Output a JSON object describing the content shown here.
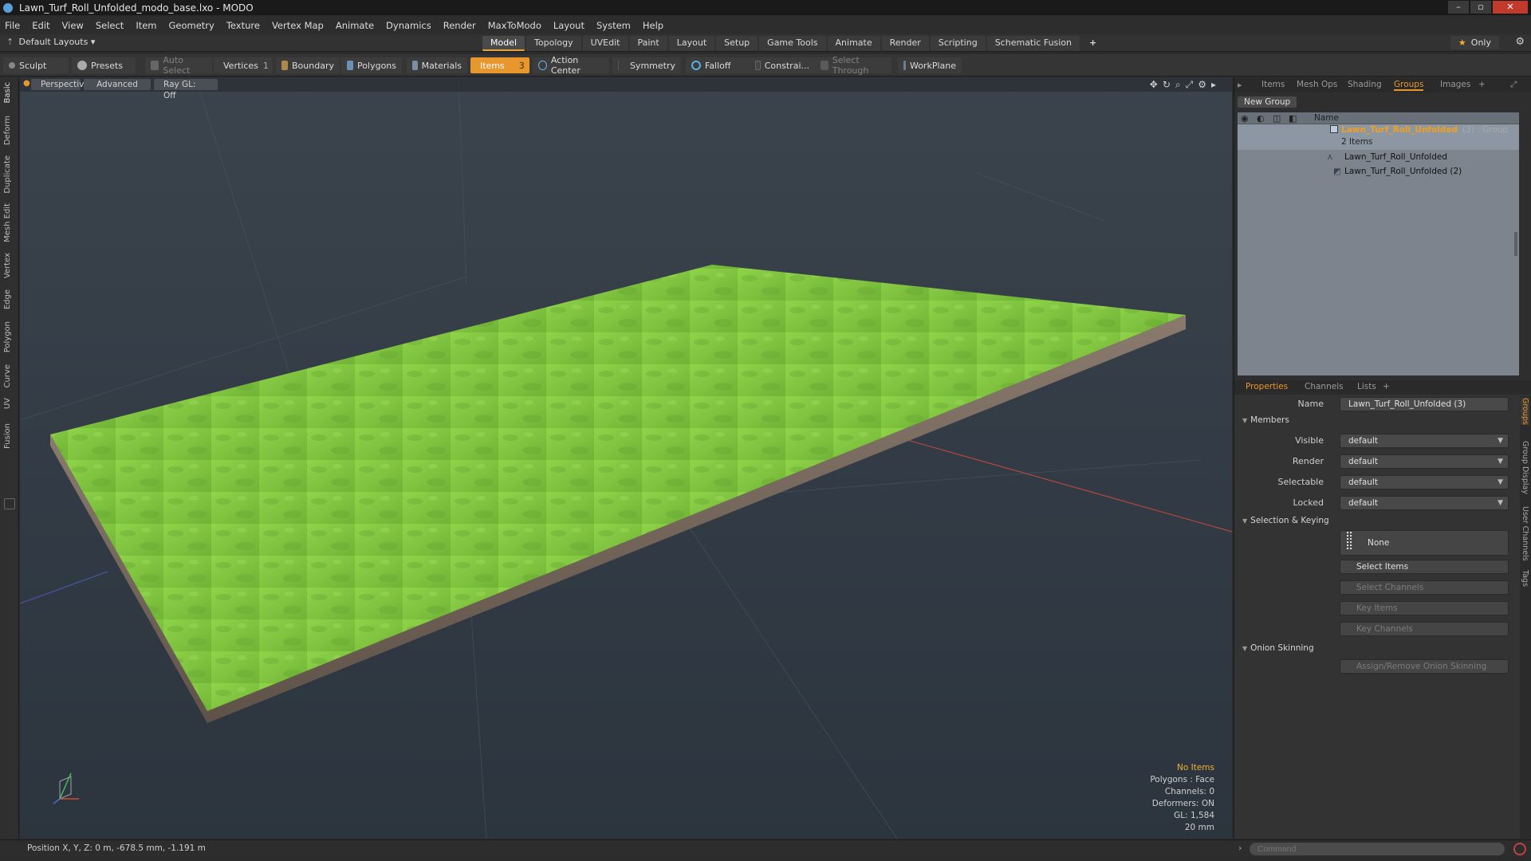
{
  "window": {
    "title": "Lawn_Turf_Roll_Unfolded_modo_base.lxo - MODO"
  },
  "menu": [
    "File",
    "Edit",
    "View",
    "Select",
    "Item",
    "Geometry",
    "Texture",
    "Vertex Map",
    "Animate",
    "Dynamics",
    "Render",
    "MaxToModo",
    "Layout",
    "System",
    "Help"
  ],
  "layout_dropdown": "Default Layouts",
  "layout_tabs": [
    "Model",
    "Topology",
    "UVEdit",
    "Paint",
    "Layout",
    "Setup",
    "Game Tools",
    "Animate",
    "Render",
    "Scripting",
    "Schematic Fusion"
  ],
  "active_layout_tab": "Model",
  "only_label": "Only",
  "toolbar": {
    "sculpt": "Sculpt",
    "presets": "Presets",
    "auto_select": "Auto Select",
    "vertices": "Vertices",
    "vertices_count": "1",
    "boundary": "Boundary",
    "polygons": "Polygons",
    "materials": "Materials",
    "items": "Items",
    "items_count": "3",
    "action_center": "Action Center",
    "symmetry": "Symmetry",
    "falloff": "Falloff",
    "constraint": "Constrai...",
    "select_through": "Select Through",
    "workplane": "WorkPlane"
  },
  "left_tabs": [
    "Basic",
    "Deform",
    "Duplicate",
    "Mesh Edit",
    "Vertex",
    "Edge",
    "Polygon",
    "Curve",
    "UV",
    "Fusion"
  ],
  "viewport": {
    "perspective": "Perspective",
    "advanced": "Advanced",
    "raygl": "Ray GL: Off",
    "hud": {
      "selection": "No Items",
      "polygons": "Polygons : Face",
      "channels": "Channels: 0",
      "deformers": "Deformers: ON",
      "gl": "GL: 1,584",
      "scale": "20 mm"
    },
    "colors": {
      "grass": "#7cc03c",
      "soil": "#7a6a5e",
      "bg_top": "#3b434c",
      "bg_bottom": "#2c353e"
    }
  },
  "groups_panel": {
    "tabs": [
      "Items",
      "Mesh Ops",
      "Shading",
      "Groups",
      "Images"
    ],
    "active_tab": "Groups",
    "new_group": "New Group",
    "column_name": "Name",
    "group": {
      "name": "Lawn_Turf_Roll_Unfolded",
      "suffix": "(3) : Group",
      "count": "2 Items"
    },
    "members": [
      "Lawn_Turf_Roll_Unfolded",
      "Lawn_Turf_Roll_Unfolded (2)"
    ]
  },
  "properties": {
    "tabs": [
      "Properties",
      "Channels",
      "Lists"
    ],
    "active_tab": "Properties",
    "name_label": "Name",
    "name_value": "Lawn_Turf_Roll_Unfolded (3)",
    "members_section": "Members",
    "fields": [
      {
        "label": "Visible",
        "value": "default"
      },
      {
        "label": "Render",
        "value": "default"
      },
      {
        "label": "Selectable",
        "value": "default"
      },
      {
        "label": "Locked",
        "value": "default"
      }
    ],
    "selection_section": "Selection & Keying",
    "none_label": "None",
    "select_items": "Select Items",
    "select_channels": "Select Channels",
    "key_items": "Key Items",
    "key_channels": "Key Channels",
    "onion_section": "Onion Skinning",
    "onion_button": "Assign/Remove Onion Skinning",
    "side_tabs": [
      "Groups",
      "Group Display",
      "User Channels",
      "Tags"
    ]
  },
  "status": {
    "position": "Position X, Y, Z:  0 m, -678.5 mm, -1.191 m"
  },
  "command": {
    "placeholder": "Command"
  }
}
